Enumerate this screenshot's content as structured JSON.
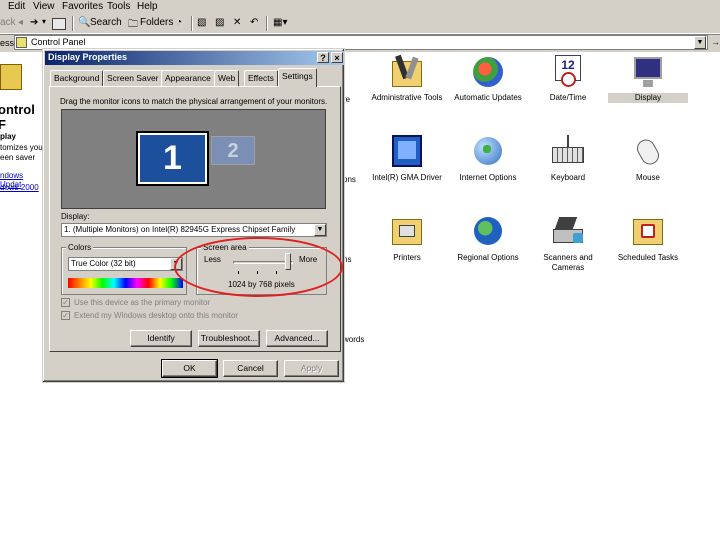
{
  "menu": [
    "Edit",
    "View",
    "Favorites",
    "Tools",
    "Help"
  ],
  "toolbar": {
    "back": "ack",
    "search": "Search",
    "folders": "Folders"
  },
  "address": {
    "label": "ess",
    "value": "Control Panel"
  },
  "left_pane": {
    "title": "ontrol F",
    "heading": "play",
    "desc1": "tomizes you",
    "desc2": "een saver",
    "link1": "ndows Updat",
    "link2": "dows 2000"
  },
  "partial_labels": {
    "re": "re",
    "ons": "ons",
    "ns": "ns",
    "words": "words"
  },
  "icons": [
    {
      "label": "Administrative Tools"
    },
    {
      "label": "Automatic Updates"
    },
    {
      "label": "Date/Time"
    },
    {
      "label": "Display"
    },
    {
      "label": "Intel(R) GMA Driver"
    },
    {
      "label": "Internet Options"
    },
    {
      "label": "Keyboard"
    },
    {
      "label": "Mouse"
    },
    {
      "label": "Printers"
    },
    {
      "label": "Regional Options"
    },
    {
      "label": "Scanners and Cameras"
    },
    {
      "label": "Scheduled Tasks"
    }
  ],
  "dialog": {
    "title": "Display Properties",
    "help_btn": "?",
    "close_btn": "×",
    "tabs": [
      "Background",
      "Screen Saver",
      "Appearance",
      "Web",
      "Effects",
      "Settings"
    ],
    "instruction": "Drag the monitor icons to match the physical arrangement of your monitors.",
    "monitor1": "1",
    "monitor2": "2",
    "display_label": "Display:",
    "display_value": "1. (Multiple Monitors) on Intel(R) 82945G Express Chipset Family",
    "colors_label": "Colors",
    "colors_value": "True Color (32 bit)",
    "screen_area_label": "Screen area",
    "less": "Less",
    "more": "More",
    "resolution": "1024 by 768 pixels",
    "primary_checkbox": "Use this device as the primary monitor",
    "extend_checkbox": "Extend my Windows desktop onto this monitor",
    "identify": "Identify",
    "troubleshoot": "Troubleshoot...",
    "advanced": "Advanced...",
    "ok": "OK",
    "cancel": "Cancel",
    "apply": "Apply"
  }
}
